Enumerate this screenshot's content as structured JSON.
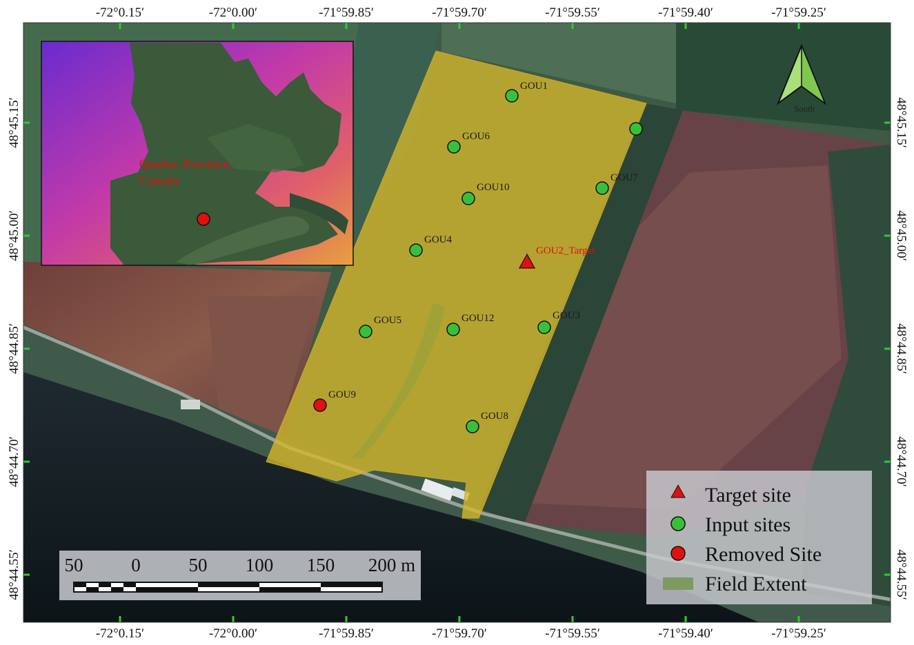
{
  "top_axis_labels": [
    "-72°0.15′",
    "-72°0.00′",
    "-71°59.85′",
    "-71°59.70′",
    "-71°59.55′",
    "-71°59.40′",
    "-71°59.25′"
  ],
  "bottom_axis_labels": [
    "-72°0.15′",
    "-72°0.00′",
    "-71°59.85′",
    "-71°59.70′",
    "-71°59.55′",
    "-71°59.40′",
    "-71°59.25′"
  ],
  "left_axis_labels": [
    "48°45.15′",
    "48°45.00′",
    "48°44.85′",
    "48°44.70′",
    "48°44.55′"
  ],
  "right_axis_labels": [
    "48°45.15′",
    "48°45.00′",
    "48°44.85′",
    "48°44.70′",
    "48°44.55′"
  ],
  "sites": [
    {
      "label": "GOU1",
      "kind": "input"
    },
    {
      "label": "",
      "kind": "input"
    },
    {
      "label": "GOU6",
      "kind": "input"
    },
    {
      "label": "GOU7",
      "kind": "input"
    },
    {
      "label": "GOU10",
      "kind": "input"
    },
    {
      "label": "GOU4",
      "kind": "input"
    },
    {
      "label": "GOU2_Target",
      "kind": "target"
    },
    {
      "label": "GOU5",
      "kind": "input"
    },
    {
      "label": "GOU12",
      "kind": "input"
    },
    {
      "label": "GOU3",
      "kind": "input"
    },
    {
      "label": "GOU9",
      "kind": "removed"
    },
    {
      "label": "GOU8",
      "kind": "input"
    }
  ],
  "inset": {
    "label_line1": "Quebec Province,",
    "label_line2": "Canada"
  },
  "north_arrow": {
    "label": "South",
    "icon": "north-arrow-icon"
  },
  "legend": {
    "items": [
      {
        "label": "Target site",
        "symbol": "triangle",
        "color": "#e01010"
      },
      {
        "label": "Input sites",
        "symbol": "circle",
        "color": "#39c03a"
      },
      {
        "label": "Removed Site",
        "symbol": "circle",
        "color": "#e01010"
      },
      {
        "label": "Field Extent",
        "symbol": "rect",
        "color": "#7e9a62"
      }
    ]
  },
  "scale_bar": {
    "labels": [
      "50",
      "0",
      "50",
      "100",
      "150",
      "200 m"
    ]
  },
  "colors": {
    "field_extent": "#d6b72c",
    "input_site": "#39c03a",
    "target_site": "#e01010",
    "removed_site": "#e01010",
    "grid_tick": "#2ecc2e"
  }
}
